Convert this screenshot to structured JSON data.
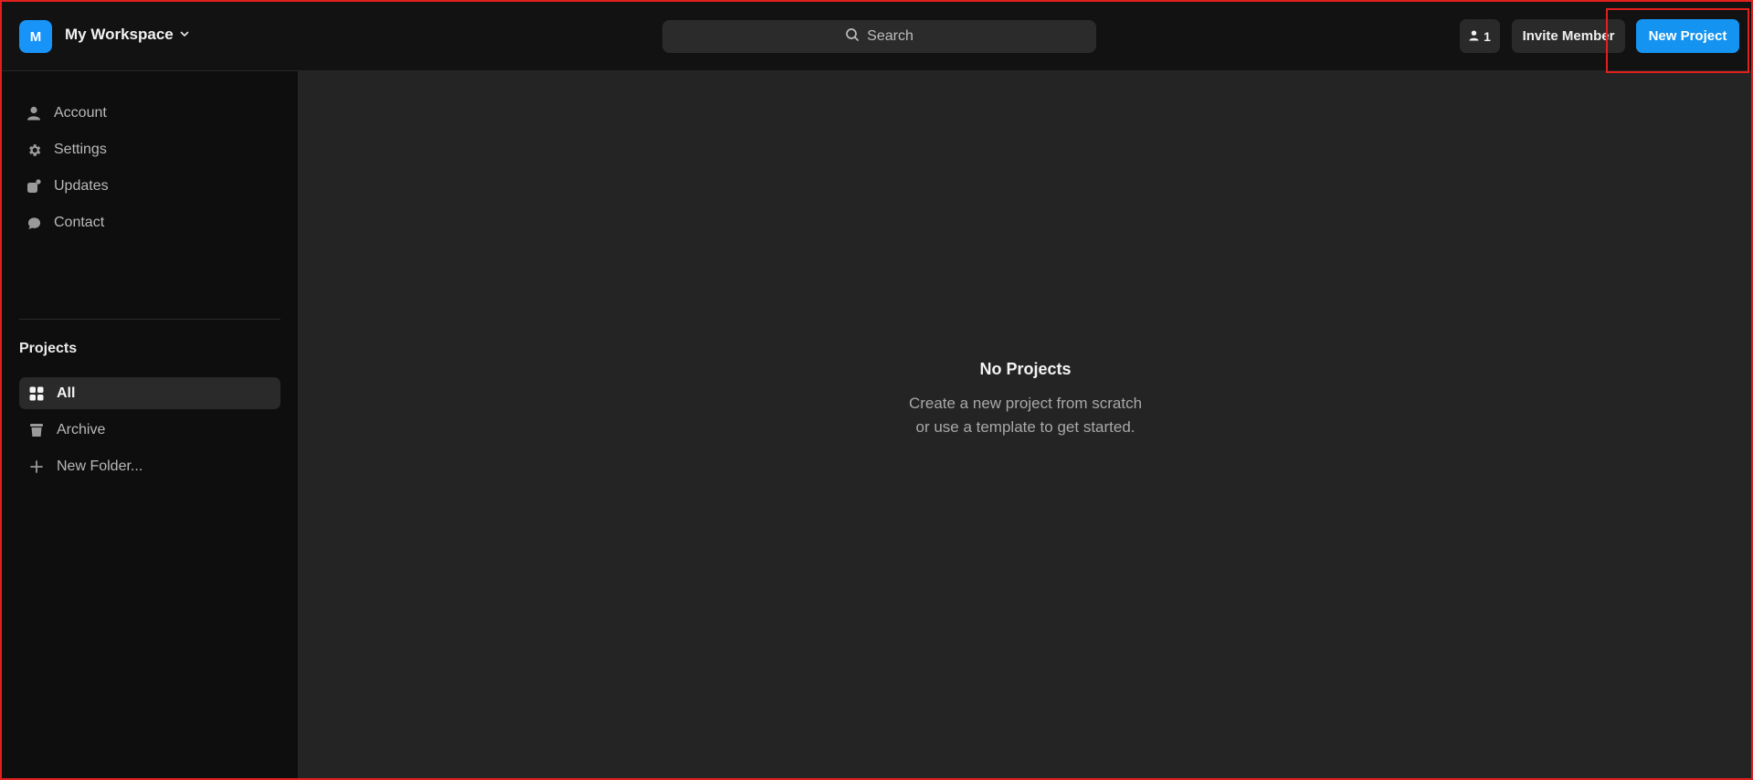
{
  "header": {
    "workspace_initial": "M",
    "workspace_name": "My Workspace",
    "search_placeholder": "Search",
    "member_count": "1",
    "invite_label": "Invite Member",
    "new_project_label": "New Project"
  },
  "sidebar": {
    "items": [
      {
        "label": "Account",
        "icon": "user-icon"
      },
      {
        "label": "Settings",
        "icon": "gear-icon"
      },
      {
        "label": "Updates",
        "icon": "updates-icon"
      },
      {
        "label": "Contact",
        "icon": "chat-bubble-icon"
      }
    ],
    "projects_title": "Projects",
    "projects": [
      {
        "label": "All",
        "icon": "grid-icon",
        "selected": true
      },
      {
        "label": "Archive",
        "icon": "trash-icon"
      },
      {
        "label": "New Folder...",
        "icon": "plus-icon"
      }
    ]
  },
  "main": {
    "empty_title": "No Projects",
    "empty_line1": "Create a new project from scratch",
    "empty_line2": "or use a template to get started."
  },
  "colors": {
    "accent": "#1493f0",
    "highlight": "#e0201c",
    "sidebar_bg": "#0e0e0e",
    "main_bg": "#242424"
  }
}
